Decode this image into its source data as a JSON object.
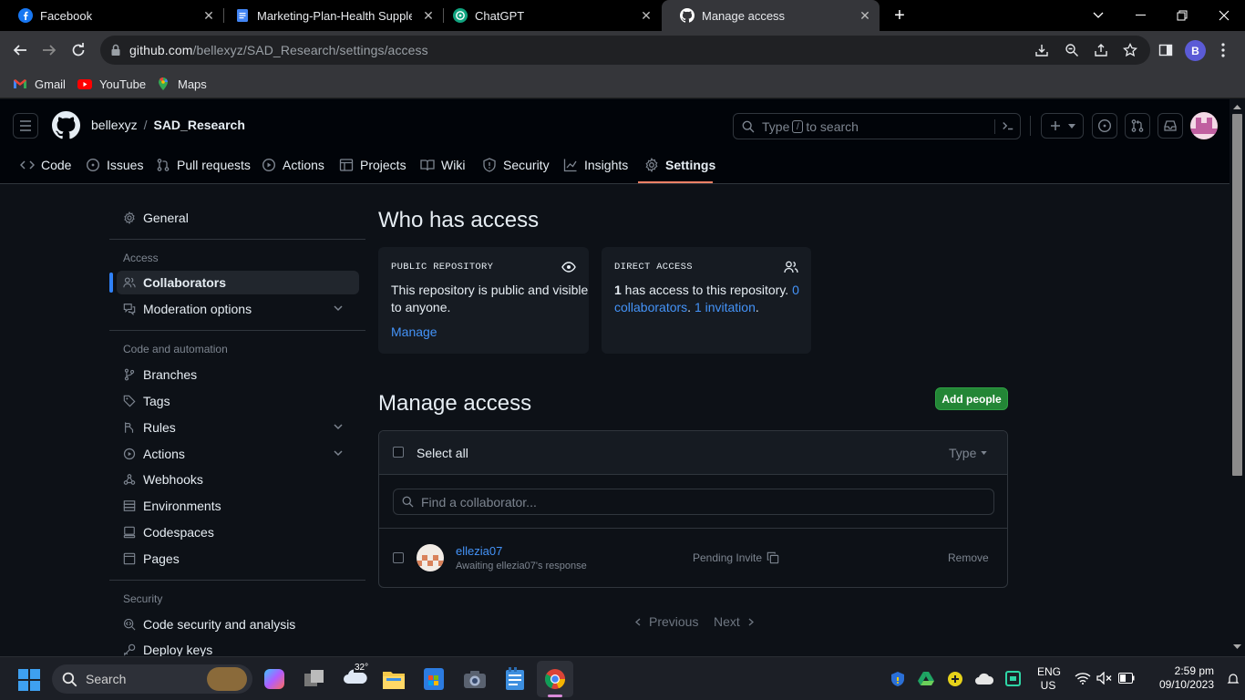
{
  "browser": {
    "tabs": [
      {
        "title": "Facebook",
        "icon": "facebook-icon"
      },
      {
        "title": "Marketing-Plan-Health Supplem",
        "icon": "docs-icon"
      },
      {
        "title": "ChatGPT",
        "icon": "chatgpt-icon"
      },
      {
        "title": "Manage access",
        "icon": "github-icon"
      }
    ],
    "url_domain": "github.com",
    "url_path": "/bellexyz/SAD_Research/settings/access",
    "profile_initial": "B",
    "bookmarks": [
      "Gmail",
      "YouTube",
      "Maps"
    ]
  },
  "github": {
    "owner": "bellexyz",
    "separator": "/",
    "repo": "SAD_Research",
    "search_prefix": "Type",
    "search_key": "/",
    "search_suffix": "to search",
    "repo_nav": [
      "Code",
      "Issues",
      "Pull requests",
      "Actions",
      "Projects",
      "Wiki",
      "Security",
      "Insights",
      "Settings"
    ]
  },
  "sidebar": {
    "general": "General",
    "access_heading": "Access",
    "collaborators": "Collaborators",
    "moderation": "Moderation options",
    "code_heading": "Code and automation",
    "code_items": [
      "Branches",
      "Tags",
      "Rules",
      "Actions",
      "Webhooks",
      "Environments",
      "Codespaces",
      "Pages"
    ],
    "security_heading": "Security",
    "security_items": [
      "Code security and analysis",
      "Deploy keys"
    ]
  },
  "main": {
    "who_title": "Who has access",
    "public_label": "PUBLIC REPOSITORY",
    "public_text_1": "This repository is public and visible",
    "public_text_2": "to anyone.",
    "manage_link": "Manage",
    "direct_label": "DIRECT ACCESS",
    "direct_count": "1",
    "direct_text": " has access to this repository. ",
    "collab_num": "0",
    "collab_word": "collaborators",
    "dot1": ".",
    "invitations": "1 invitation",
    "dot2": ".",
    "manage_title": "Manage access",
    "add_people": "Add people",
    "select_all": "Select all",
    "type_filter": "Type",
    "find_placeholder": "Find a collaborator...",
    "collaborator": {
      "username": "ellezia07",
      "status": "Awaiting ellezia07's response",
      "invite": "Pending Invite",
      "remove": "Remove"
    },
    "prev": "Previous",
    "next": "Next"
  },
  "taskbar": {
    "search": "Search",
    "weather": "32°",
    "lang_1": "ENG",
    "lang_2": "US",
    "time": "2:59 pm",
    "date": "09/10/2023"
  },
  "colors": {
    "accent": "#4493f8",
    "green": "#238636",
    "settings_underline": "#f78166"
  }
}
